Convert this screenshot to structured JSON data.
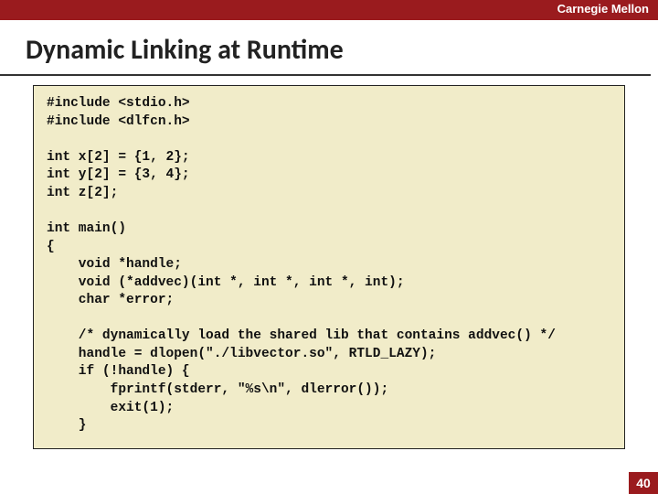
{
  "header": {
    "brand": "Carnegie Mellon"
  },
  "slide": {
    "title": "Dynamic Linking at Runtime",
    "page_number": "40"
  },
  "code": {
    "text": "#include <stdio.h>\n#include <dlfcn.h>\n\nint x[2] = {1, 2};\nint y[2] = {3, 4};\nint z[2];\n\nint main()\n{\n    void *handle;\n    void (*addvec)(int *, int *, int *, int);\n    char *error;\n\n    /* dynamically load the shared lib that contains addvec() */\n    handle = dlopen(\"./libvector.so\", RTLD_LAZY);\n    if (!handle) {\n        fprintf(stderr, \"%s\\n\", dlerror());\n        exit(1);\n    }"
  }
}
